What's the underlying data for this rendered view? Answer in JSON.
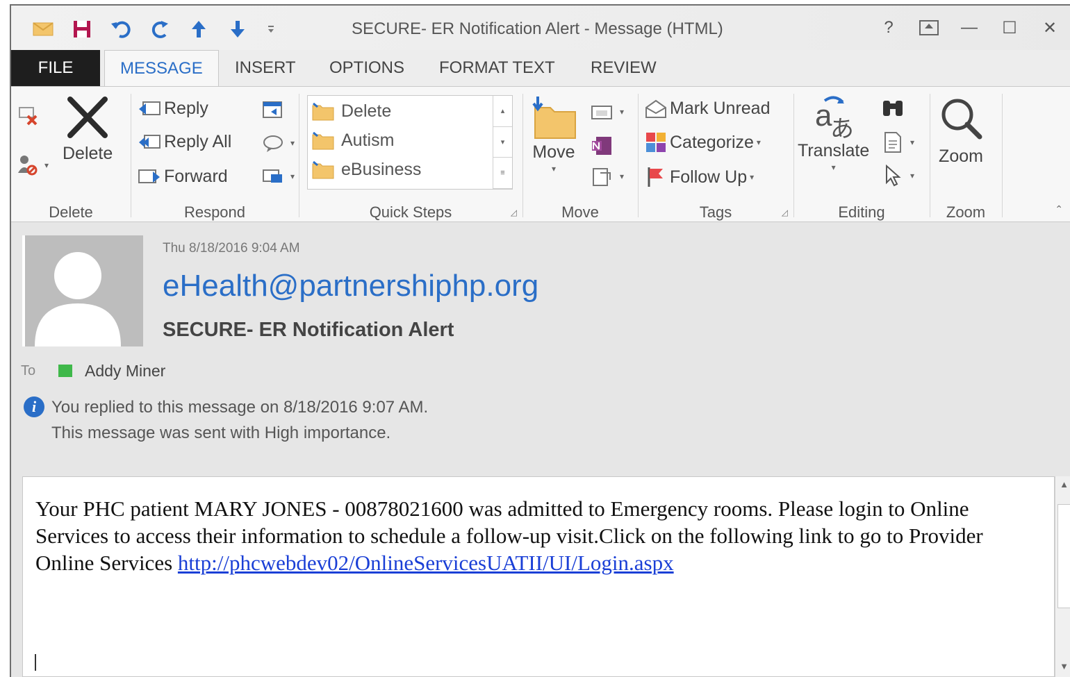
{
  "window": {
    "title": "SECURE- ER Notification Alert - Message (HTML)",
    "controls": [
      "?",
      "↑",
      "—",
      "☐",
      "✕"
    ]
  },
  "quick_access": {
    "undo_icon": "undo-icon",
    "redo_icon": "redo-icon"
  },
  "tabs": {
    "file": "FILE",
    "message": "MESSAGE",
    "insert": "INSERT",
    "options": "OPTIONS",
    "format_text": "FORMAT TEXT",
    "review": "REVIEW"
  },
  "ribbon": {
    "delete_group": {
      "label": "Delete",
      "delete_button": "Delete"
    },
    "respond_group": {
      "label": "Respond",
      "reply": "Reply",
      "reply_all": "Reply All",
      "forward": "Forward"
    },
    "quick_steps_group": {
      "label": "Quick Steps",
      "items": [
        "Delete",
        "Autism",
        "eBusiness"
      ]
    },
    "move_group": {
      "label": "Move",
      "move_button": "Move"
    },
    "tags_group": {
      "label": "Tags",
      "mark_unread": "Mark Unread",
      "categorize": "Categorize",
      "follow_up": "Follow Up"
    },
    "editing_group": {
      "label": "Editing",
      "translate": "Translate"
    },
    "zoom_group": {
      "label": "Zoom",
      "zoom_button": "Zoom"
    }
  },
  "message": {
    "date": "Thu 8/18/2016 9:04 AM",
    "sender": "eHealth@partnershiphp.org",
    "subject": "SECURE- ER Notification Alert",
    "to_label": "To",
    "to_name": "Addy Miner",
    "info_line_1": "You replied to this message on 8/18/2016 9:07 AM.",
    "info_line_2": "This message was sent with High importance.",
    "body_text": "Your PHC patient MARY JONES - 00878021600 was admitted to Emergency rooms. Please login to Online Services to access their information to schedule a follow-up visit.Click on the following link to go to Provider Online Services ",
    "body_link": "http://phcwebdev02/OnlineServicesUATII/UI/Login.aspx"
  },
  "colors": {
    "accent": "#2a6ec7",
    "link": "#1a3fd6",
    "presence": "#3fb84a",
    "file_tab": "#1e1e1e"
  }
}
